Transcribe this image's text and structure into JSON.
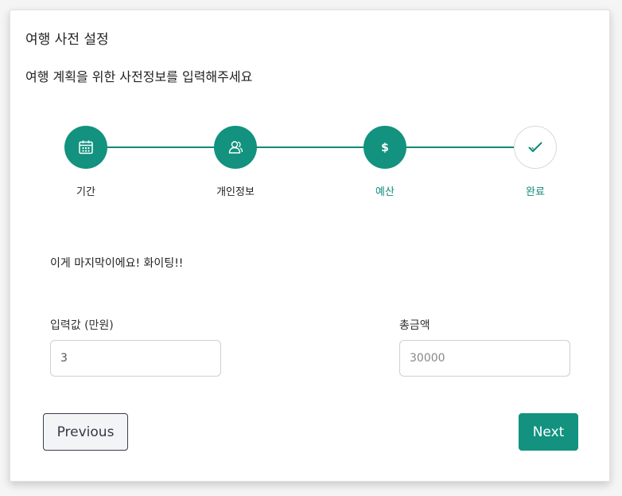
{
  "header": {
    "title": "여행 사전 설정",
    "subtitle": "여행 계획을 위한 사전정보를 입력해주세요"
  },
  "stepper": {
    "steps": [
      {
        "label": "기간",
        "icon": "calendar-icon",
        "state": "completed"
      },
      {
        "label": "개인정보",
        "icon": "users-icon",
        "state": "completed"
      },
      {
        "label": "예산",
        "icon": "dollar-icon",
        "state": "active"
      },
      {
        "label": "완료",
        "icon": "check-icon",
        "state": "pending"
      }
    ]
  },
  "main": {
    "message": "이게 마지막이에요! 화이팅!!",
    "input_label": "입력값 (만원)",
    "input_value": "3",
    "total_label": "총금액",
    "total_placeholder": "30000"
  },
  "buttons": {
    "previous_label": "Previous",
    "next_label": "Next"
  },
  "colors": {
    "accent": "#12927f",
    "line": "#12887b"
  }
}
